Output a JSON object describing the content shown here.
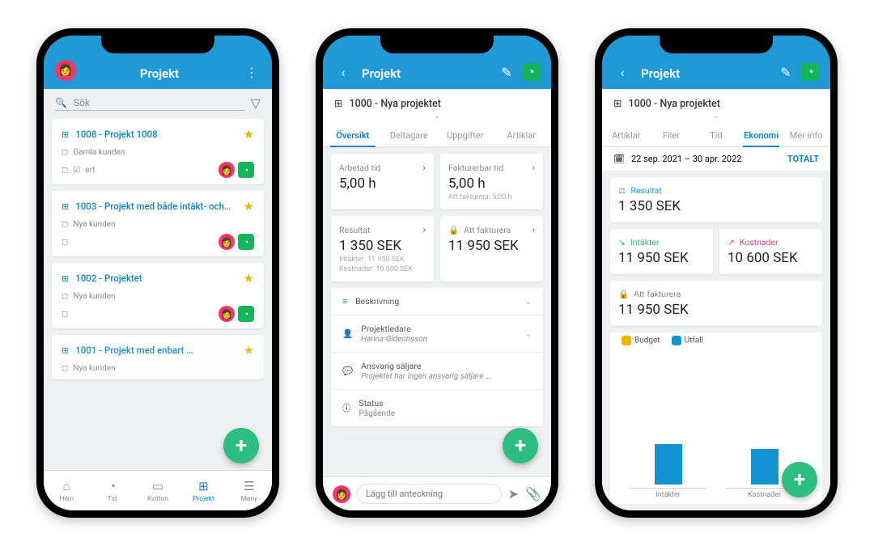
{
  "phone1": {
    "title": "Projekt",
    "search_placeholder": "Sök",
    "projects": [
      {
        "title": "1008 - Projekt 1008",
        "customer": "Gamla kunden",
        "note": "ert"
      },
      {
        "title": "1003 - Projekt med både intäkt- och…",
        "customer": "Nya kunden",
        "note": ""
      },
      {
        "title": "1002 - Projektet",
        "customer": "Nya kunden",
        "note": ""
      },
      {
        "title": "1001 - Projekt med enbart …",
        "customer": "Nya kunden",
        "note": ""
      }
    ],
    "tabbar": {
      "hem": "Hem",
      "tid": "Tid",
      "kvitton": "Kvitton",
      "projekt": "Projekt",
      "meny": "Meny"
    }
  },
  "phone2": {
    "title": "Projekt",
    "proj_name": "1000 - Nya projektet",
    "tabs": {
      "oversikt": "Översikt",
      "deltagare": "Deltagare",
      "uppgifter": "Uppgifter",
      "artiklar": "Artiklar"
    },
    "tiles": {
      "arbetad_lbl": "Arbetad tid",
      "arbetad_val": "5,00 h",
      "fakt_tid_lbl": "Fakturerbar tid",
      "fakt_tid_val": "5,00 h",
      "fakt_tid_sub": "Att fakturera: 5,00 h",
      "resultat_lbl": "Resultat",
      "resultat_val": "1 350 SEK",
      "resultat_sub1": "Intäkter: 11 950 SEK",
      "resultat_sub2": "Kostnader: 10 600 SEK",
      "attfakt_lbl": "Att fakturera",
      "attfakt_val": "11 950 SEK"
    },
    "rows": {
      "beskrivning": "Beskrivning",
      "projektledare_lbl": "Projektledare",
      "projektledare_val": "Hanna Gideonsson",
      "ansvarig_lbl": "Ansvarig säljare",
      "ansvarig_val": "Projektet har ingen ansvarig säljare …",
      "status_lbl": "Status",
      "status_val": "Pågående"
    },
    "note_placeholder": "Lägg till anteckning"
  },
  "phone3": {
    "title": "Projekt",
    "proj_name": "1000 - Nya projektet",
    "tabs": {
      "artiklar": "Artiklar",
      "filer": "Filer",
      "tid": "Tid",
      "ekonomi": "Ekonomi",
      "mer": "Mer info"
    },
    "daterange": "22 sep. 2021 – 30 apr. 2022",
    "totalt": "TOTALT",
    "resultat_lbl": "Resultat",
    "resultat_val": "1 350 SEK",
    "intakter_lbl": "Intäkter",
    "intakter_val": "11 950 SEK",
    "kostnader_lbl": "Kostnader",
    "kostnader_val": "10 600 SEK",
    "attfakt_lbl": "Att fakturera",
    "attfakt_val": "11 950 SEK",
    "legend_budget": "Budget",
    "legend_utfall": "Utfall",
    "xlabel_intakter": "Intäkter",
    "xlabel_kostnader": "Kostnader"
  },
  "chart_data": {
    "type": "bar",
    "categories": [
      "Intäkter",
      "Kostnader"
    ],
    "series": [
      {
        "name": "Budget",
        "values": [
          0,
          0
        ],
        "color": "#f0b400"
      },
      {
        "name": "Utfall",
        "values": [
          11950,
          10600
        ],
        "color": "#1193d4"
      }
    ],
    "ylim": [
      0,
      12000
    ],
    "title": "",
    "xlabel": "",
    "ylabel": "",
    "legend": [
      "Budget",
      "Utfall"
    ]
  }
}
